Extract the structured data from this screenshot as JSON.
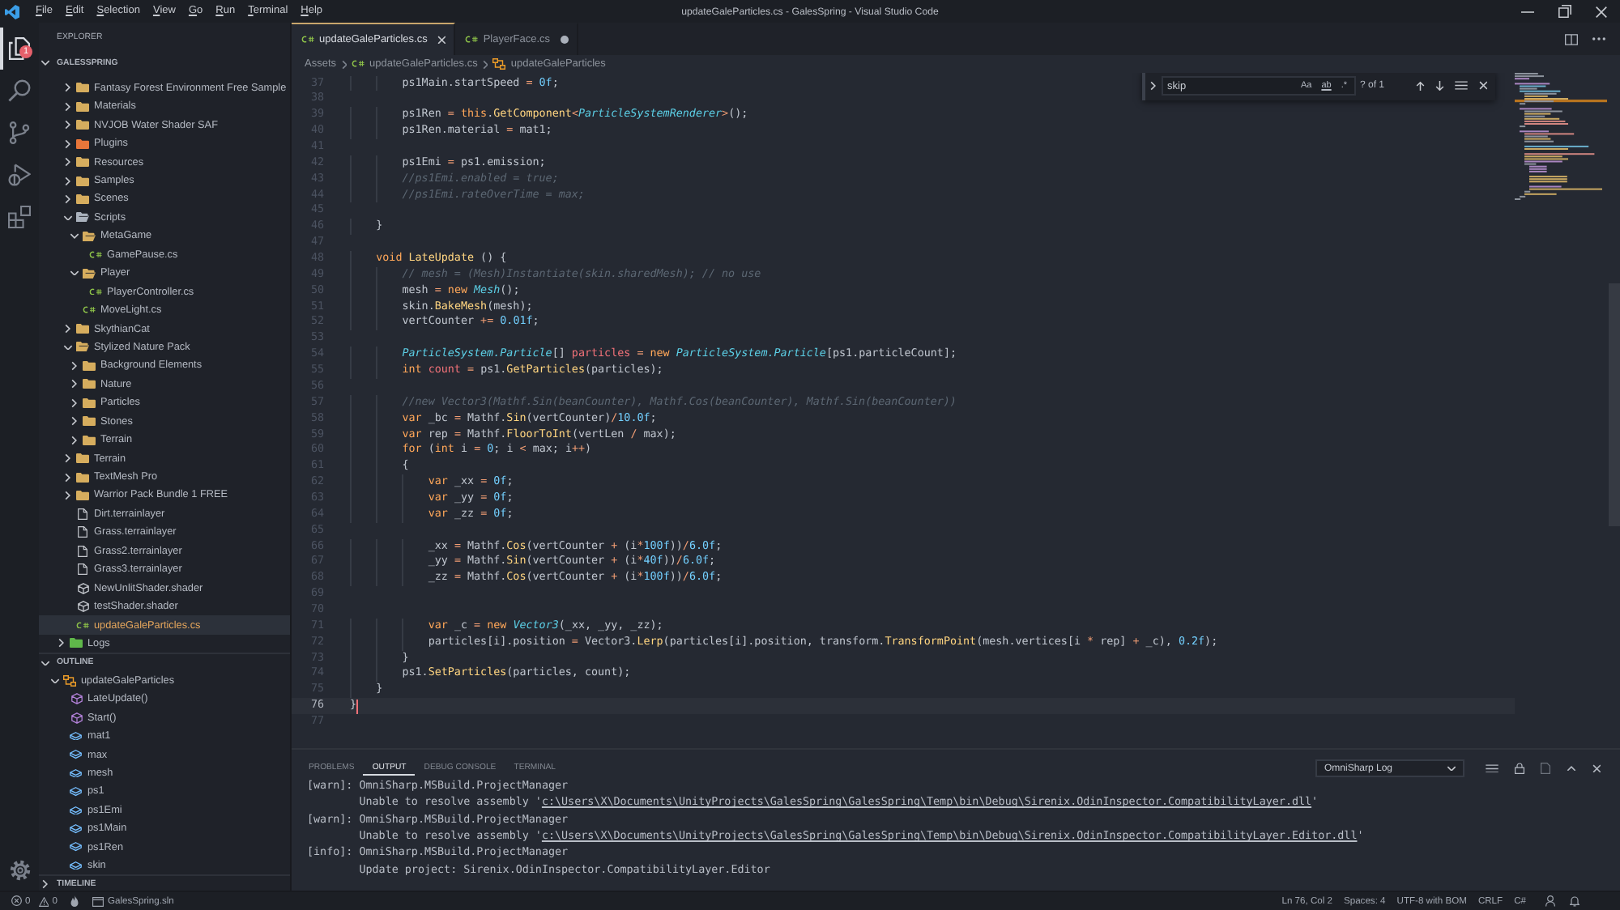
{
  "window": {
    "menu": [
      "File",
      "Edit",
      "Selection",
      "View",
      "Go",
      "Run",
      "Terminal",
      "Help"
    ],
    "title": "updateGaleParticles.cs - GalesSpring - Visual Studio Code"
  },
  "activity_bar": {
    "items": [
      {
        "kind": "files",
        "selected": true,
        "badge": "1"
      },
      {
        "kind": "search",
        "selected": false
      },
      {
        "kind": "branch",
        "selected": false
      },
      {
        "kind": "run",
        "selected": false
      },
      {
        "kind": "extensions",
        "selected": false
      }
    ]
  },
  "sidebar": {
    "title": "EXPLORER",
    "sections": [
      {
        "title": "GALESSPRING",
        "expanded": true,
        "tree": [
          {
            "children": [
              {
                "label": "Fantasy Forest Environment Free Sample",
                "kind": "folder",
                "color": "#d6ad5e",
                "expanded": false,
                "selected": false
              },
              {
                "label": "Materials",
                "kind": "folder",
                "color": "#d6ad5e",
                "expanded": false,
                "selected": false
              },
              {
                "label": "NVJOB Water Shader SAF",
                "kind": "folder",
                "color": "#d6ad5e",
                "expanded": false,
                "selected": false
              },
              {
                "label": "Plugins",
                "kind": "folder",
                "color": "#e8763a",
                "expanded": false,
                "selected": false
              },
              {
                "label": "Resources",
                "kind": "folder",
                "color": "#d6ad5e",
                "expanded": false,
                "selected": false
              },
              {
                "label": "Samples",
                "kind": "folder",
                "color": "#d6ad5e",
                "expanded": false,
                "selected": false
              },
              {
                "label": "Scenes",
                "kind": "folder",
                "color": "#d6ad5e",
                "expanded": false,
                "selected": false
              },
              {
                "label": "Scripts",
                "kind": "folder",
                "color": "#aab2bd",
                "expanded": true,
                "selected": false,
                "children": [
                  {
                    "label": "MetaGame",
                    "kind": "folder",
                    "color": "#d6ad5e",
                    "expanded": true,
                    "selected": false,
                    "children": [
                      {
                        "label": "GamePause.cs",
                        "kind": "csharp",
                        "selected": false
                      }
                    ]
                  },
                  {
                    "label": "Player",
                    "kind": "folder",
                    "color": "#d6ad5e",
                    "expanded": true,
                    "selected": false,
                    "children": [
                      {
                        "label": "PlayerController.cs",
                        "kind": "csharp",
                        "selected": false
                      }
                    ]
                  },
                  {
                    "label": "MoveLight.cs",
                    "kind": "csharp",
                    "selected": false
                  }
                ]
              },
              {
                "label": "SkythianCat",
                "kind": "folder",
                "color": "#d6ad5e",
                "expanded": false,
                "selected": false
              },
              {
                "label": "Stylized Nature Pack",
                "kind": "folder",
                "color": "#d6ad5e",
                "expanded": true,
                "selected": false,
                "children": [
                  {
                    "label": "Background Elements",
                    "kind": "folder",
                    "color": "#d6ad5e",
                    "expanded": false,
                    "selected": false
                  },
                  {
                    "label": "Nature",
                    "kind": "folder",
                    "color": "#d6ad5e",
                    "expanded": false,
                    "selected": false
                  },
                  {
                    "label": "Particles",
                    "kind": "folder",
                    "color": "#d6ad5e",
                    "expanded": false,
                    "selected": false
                  },
                  {
                    "label": "Stones",
                    "kind": "folder",
                    "color": "#d6ad5e",
                    "expanded": false,
                    "selected": false
                  },
                  {
                    "label": "Terrain",
                    "kind": "folder",
                    "color": "#d6ad5e",
                    "expanded": false,
                    "selected": false
                  }
                ]
              },
              {
                "label": "Terrain",
                "kind": "folder",
                "color": "#d6ad5e",
                "expanded": false,
                "selected": false
              },
              {
                "label": "TextMesh Pro",
                "kind": "folder",
                "color": "#d6ad5e",
                "expanded": false,
                "selected": false
              },
              {
                "label": "Warrior Pack Bundle 1 FREE",
                "kind": "folder",
                "color": "#d6ad5e",
                "expanded": false,
                "selected": false
              },
              {
                "label": "Dirt.terrainlayer",
                "kind": "layer",
                "selected": false
              },
              {
                "label": "Grass.terrainlayer",
                "kind": "layer",
                "selected": false
              },
              {
                "label": "Grass2.terrainlayer",
                "kind": "layer",
                "selected": false
              },
              {
                "label": "Grass3.terrainlayer",
                "kind": "layer",
                "selected": false
              },
              {
                "label": "NewUnlitShader.shader",
                "kind": "shader",
                "selected": false
              },
              {
                "label": "testShader.shader",
                "kind": "shader",
                "selected": false
              },
              {
                "label": "updateGaleParticles.cs",
                "kind": "csharp",
                "selected": true
              }
            ]
          },
          {
            "label": "Logs",
            "kind": "folder",
            "color": "#5fb84a",
            "expanded": false,
            "selected": false
          }
        ]
      },
      {
        "title": "OUTLINE",
        "expanded": true,
        "symbols": [
          {
            "label": "updateGaleParticles",
            "kind": "class",
            "expanded": true,
            "selected": false,
            "children": [
              {
                "label": "LateUpdate()",
                "kind": "method",
                "selected": false
              },
              {
                "label": "Start()",
                "kind": "method",
                "selected": false
              },
              {
                "label": "mat1",
                "kind": "field",
                "selected": false
              },
              {
                "label": "max",
                "kind": "field",
                "selected": false
              },
              {
                "label": "mesh",
                "kind": "field",
                "selected": false
              },
              {
                "label": "ps1",
                "kind": "field",
                "selected": false
              },
              {
                "label": "ps1Emi",
                "kind": "field",
                "selected": false
              },
              {
                "label": "ps1Main",
                "kind": "field",
                "selected": false
              },
              {
                "label": "ps1Ren",
                "kind": "field",
                "selected": false
              },
              {
                "label": "skin",
                "kind": "field",
                "selected": false
              }
            ]
          }
        ]
      },
      {
        "title": "TIMELINE",
        "expanded": false
      }
    ]
  },
  "editor": {
    "tabs": [
      {
        "label": "updateGaleParticles.cs",
        "selected": true,
        "dirty": false
      },
      {
        "label": "PlayerFace.cs",
        "selected": false,
        "dirty": true
      }
    ],
    "breadcrumbs": [
      {
        "label": "Assets",
        "kind": "folder"
      },
      {
        "label": "updateGaleParticles.cs",
        "kind": "csharp"
      },
      {
        "label": "updateGaleParticles",
        "kind": "class"
      }
    ],
    "find": {
      "query": "skip",
      "toggles": [
        {
          "label": "Aa",
          "on": false
        },
        {
          "label": "ab",
          "on": false
        },
        {
          "label": ".*",
          "on": false
        }
      ],
      "result": "? of 1"
    },
    "lines": [
      {
        "number": "37",
        "current": false,
        "tokens": [
          {
            "kind": "plain",
            "text": "        ps1Main.startSpeed "
          },
          {
            "kind": "operator",
            "text": "= "
          },
          {
            "kind": "number",
            "text": "0f"
          },
          {
            "kind": "plain",
            "text": ";"
          }
        ]
      },
      {
        "number": "38",
        "current": false
      },
      {
        "number": "39",
        "current": false,
        "tokens": [
          {
            "kind": "plain",
            "text": "        ps1Ren "
          },
          {
            "kind": "operator",
            "text": "= "
          },
          {
            "kind": "keyword",
            "text": "this"
          },
          {
            "kind": "plain",
            "text": "."
          },
          {
            "kind": "function",
            "text": "GetComponent"
          },
          {
            "kind": "operator",
            "text": "<"
          },
          {
            "kind": "type",
            "text": "ParticleSystemRenderer"
          },
          {
            "kind": "operator",
            "text": ">"
          },
          {
            "kind": "plain",
            "text": "();"
          }
        ]
      },
      {
        "number": "40",
        "current": false,
        "tokens": [
          {
            "kind": "plain",
            "text": "        ps1Ren.material "
          },
          {
            "kind": "operator",
            "text": "="
          },
          {
            "kind": "plain",
            "text": " mat1;"
          }
        ]
      },
      {
        "number": "41",
        "current": false
      },
      {
        "number": "42",
        "current": false,
        "tokens": [
          {
            "kind": "plain",
            "text": "        ps1Emi "
          },
          {
            "kind": "operator",
            "text": "="
          },
          {
            "kind": "plain",
            "text": " ps1.emission;"
          }
        ]
      },
      {
        "number": "43",
        "current": false,
        "tokens": [
          {
            "kind": "comment",
            "text": "        //ps1Emi.enabled = true;"
          }
        ]
      },
      {
        "number": "44",
        "current": false,
        "tokens": [
          {
            "kind": "comment",
            "text": "        //ps1Emi.rateOverTime = max;"
          }
        ]
      },
      {
        "number": "45",
        "current": false
      },
      {
        "number": "46",
        "current": false,
        "tokens": [
          {
            "kind": "plain",
            "text": "    }"
          }
        ]
      },
      {
        "number": "47",
        "current": false
      },
      {
        "number": "48",
        "current": false,
        "tokens": [
          {
            "kind": "keyword",
            "text": "    void "
          },
          {
            "kind": "function",
            "text": "LateUpdate"
          },
          {
            "kind": "plain",
            "text": " () {"
          }
        ]
      },
      {
        "number": "49",
        "current": false,
        "tokens": [
          {
            "kind": "comment",
            "text": "        // mesh = (Mesh)Instantiate(skin.sharedMesh); // no use"
          }
        ]
      },
      {
        "number": "50",
        "current": false,
        "tokens": [
          {
            "kind": "plain",
            "text": "        mesh "
          },
          {
            "kind": "operator",
            "text": "= "
          },
          {
            "kind": "keyword",
            "text": "new "
          },
          {
            "kind": "type",
            "text": "Mesh"
          },
          {
            "kind": "plain",
            "text": "();"
          }
        ]
      },
      {
        "number": "51",
        "current": false,
        "tokens": [
          {
            "kind": "plain",
            "text": "        skin."
          },
          {
            "kind": "function",
            "text": "BakeMesh"
          },
          {
            "kind": "plain",
            "text": "(mesh);"
          }
        ]
      },
      {
        "number": "52",
        "current": false,
        "tokens": [
          {
            "kind": "plain",
            "text": "        vertCounter "
          },
          {
            "kind": "operator",
            "text": "+= "
          },
          {
            "kind": "number",
            "text": "0.01f"
          },
          {
            "kind": "plain",
            "text": ";"
          }
        ]
      },
      {
        "number": "53",
        "current": false
      },
      {
        "number": "54",
        "current": false,
        "tokens": [
          {
            "kind": "type",
            "text": "        ParticleSystem.Particle"
          },
          {
            "kind": "plain",
            "text": "[] "
          },
          {
            "kind": "variable",
            "text": "particles "
          },
          {
            "kind": "operator",
            "text": "= "
          },
          {
            "kind": "keyword",
            "text": "new "
          },
          {
            "kind": "type",
            "text": "ParticleSystem.Particle"
          },
          {
            "kind": "plain",
            "text": "[ps1.particleCount];"
          }
        ]
      },
      {
        "number": "55",
        "current": false,
        "tokens": [
          {
            "kind": "keyword",
            "text": "        int "
          },
          {
            "kind": "variable",
            "text": "count "
          },
          {
            "kind": "operator",
            "text": "= "
          },
          {
            "kind": "plain",
            "text": "ps1."
          },
          {
            "kind": "function",
            "text": "GetParticles"
          },
          {
            "kind": "plain",
            "text": "(particles);"
          }
        ]
      },
      {
        "number": "56",
        "current": false
      },
      {
        "number": "57",
        "current": false,
        "tokens": [
          {
            "kind": "comment",
            "text": "        //new Vector3(Mathf.Sin(beanCounter), Mathf.Cos(beanCounter), Mathf.Sin(beanCounter))"
          }
        ]
      },
      {
        "number": "58",
        "current": false,
        "tokens": [
          {
            "kind": "keyword",
            "text": "        var"
          },
          {
            "kind": "plain",
            "text": " _bc "
          },
          {
            "kind": "operator",
            "text": "="
          },
          {
            "kind": "plain",
            "text": " Mathf."
          },
          {
            "kind": "function",
            "text": "Sin"
          },
          {
            "kind": "plain",
            "text": "(vertCounter)"
          },
          {
            "kind": "operator",
            "text": "/"
          },
          {
            "kind": "number",
            "text": "10.0f"
          },
          {
            "kind": "plain",
            "text": ";"
          }
        ]
      },
      {
        "number": "59",
        "current": false,
        "tokens": [
          {
            "kind": "keyword",
            "text": "        var"
          },
          {
            "kind": "plain",
            "text": " rep "
          },
          {
            "kind": "operator",
            "text": "="
          },
          {
            "kind": "plain",
            "text": " Mathf."
          },
          {
            "kind": "function",
            "text": "FloorToInt"
          },
          {
            "kind": "plain",
            "text": "(vertLen "
          },
          {
            "kind": "operator",
            "text": "/"
          },
          {
            "kind": "plain",
            "text": " max);"
          }
        ]
      },
      {
        "number": "60",
        "current": false,
        "tokens": [
          {
            "kind": "keyword",
            "text": "        for"
          },
          {
            "kind": "plain",
            "text": " ("
          },
          {
            "kind": "keyword",
            "text": "int"
          },
          {
            "kind": "plain",
            "text": " i "
          },
          {
            "kind": "operator",
            "text": "= "
          },
          {
            "kind": "number",
            "text": "0"
          },
          {
            "kind": "plain",
            "text": "; i "
          },
          {
            "kind": "operator",
            "text": "<"
          },
          {
            "kind": "plain",
            "text": " max; i"
          },
          {
            "kind": "operator",
            "text": "++"
          },
          {
            "kind": "plain",
            "text": ")"
          }
        ]
      },
      {
        "number": "61",
        "current": false,
        "tokens": [
          {
            "kind": "plain",
            "text": "        {"
          }
        ]
      },
      {
        "number": "62",
        "current": false,
        "tokens": [
          {
            "kind": "keyword",
            "text": "            var"
          },
          {
            "kind": "plain",
            "text": " _xx "
          },
          {
            "kind": "operator",
            "text": "= "
          },
          {
            "kind": "number",
            "text": "0f"
          },
          {
            "kind": "plain",
            "text": ";"
          }
        ]
      },
      {
        "number": "63",
        "current": false,
        "tokens": [
          {
            "kind": "keyword",
            "text": "            var"
          },
          {
            "kind": "plain",
            "text": " _yy "
          },
          {
            "kind": "operator",
            "text": "= "
          },
          {
            "kind": "number",
            "text": "0f"
          },
          {
            "kind": "plain",
            "text": ";"
          }
        ]
      },
      {
        "number": "64",
        "current": false,
        "tokens": [
          {
            "kind": "keyword",
            "text": "            var"
          },
          {
            "kind": "plain",
            "text": " _zz "
          },
          {
            "kind": "operator",
            "text": "= "
          },
          {
            "kind": "number",
            "text": "0f"
          },
          {
            "kind": "plain",
            "text": ";"
          }
        ]
      },
      {
        "number": "65",
        "current": false
      },
      {
        "number": "66",
        "current": false,
        "tokens": [
          {
            "kind": "plain",
            "text": "            _xx "
          },
          {
            "kind": "operator",
            "text": "="
          },
          {
            "kind": "plain",
            "text": " Mathf."
          },
          {
            "kind": "function",
            "text": "Cos"
          },
          {
            "kind": "plain",
            "text": "(vertCounter "
          },
          {
            "kind": "operator",
            "text": "+"
          },
          {
            "kind": "plain",
            "text": " (i"
          },
          {
            "kind": "operator",
            "text": "*"
          },
          {
            "kind": "number",
            "text": "100f"
          },
          {
            "kind": "plain",
            "text": "))"
          },
          {
            "kind": "operator",
            "text": "/"
          },
          {
            "kind": "number",
            "text": "6.0f"
          },
          {
            "kind": "plain",
            "text": ";"
          }
        ]
      },
      {
        "number": "67",
        "current": false,
        "tokens": [
          {
            "kind": "plain",
            "text": "            _yy "
          },
          {
            "kind": "operator",
            "text": "="
          },
          {
            "kind": "plain",
            "text": " Mathf."
          },
          {
            "kind": "function",
            "text": "Sin"
          },
          {
            "kind": "plain",
            "text": "(vertCounter "
          },
          {
            "kind": "operator",
            "text": "+"
          },
          {
            "kind": "plain",
            "text": " (i"
          },
          {
            "kind": "operator",
            "text": "*"
          },
          {
            "kind": "number",
            "text": "40f"
          },
          {
            "kind": "plain",
            "text": "))"
          },
          {
            "kind": "operator",
            "text": "/"
          },
          {
            "kind": "number",
            "text": "6.0f"
          },
          {
            "kind": "plain",
            "text": ";"
          }
        ]
      },
      {
        "number": "68",
        "current": false,
        "tokens": [
          {
            "kind": "plain",
            "text": "            _zz "
          },
          {
            "kind": "operator",
            "text": "="
          },
          {
            "kind": "plain",
            "text": " Mathf."
          },
          {
            "kind": "function",
            "text": "Cos"
          },
          {
            "kind": "plain",
            "text": "(vertCounter "
          },
          {
            "kind": "operator",
            "text": "+"
          },
          {
            "kind": "plain",
            "text": " (i"
          },
          {
            "kind": "operator",
            "text": "*"
          },
          {
            "kind": "number",
            "text": "100f"
          },
          {
            "kind": "plain",
            "text": "))"
          },
          {
            "kind": "operator",
            "text": "/"
          },
          {
            "kind": "number",
            "text": "6.0f"
          },
          {
            "kind": "plain",
            "text": ";"
          }
        ]
      },
      {
        "number": "69",
        "current": false
      },
      {
        "number": "70",
        "current": false
      },
      {
        "number": "71",
        "current": false,
        "tokens": [
          {
            "kind": "keyword",
            "text": "            var"
          },
          {
            "kind": "plain",
            "text": " _c "
          },
          {
            "kind": "operator",
            "text": "= "
          },
          {
            "kind": "keyword",
            "text": "new "
          },
          {
            "kind": "type",
            "text": "Vector3"
          },
          {
            "kind": "plain",
            "text": "(_xx, _yy, _zz);"
          }
        ]
      },
      {
        "number": "72",
        "current": false,
        "tokens": [
          {
            "kind": "plain",
            "text": "            particles[i].position "
          },
          {
            "kind": "operator",
            "text": "="
          },
          {
            "kind": "plain",
            "text": " Vector3."
          },
          {
            "kind": "function",
            "text": "Lerp"
          },
          {
            "kind": "plain",
            "text": "(particles[i].position, transform."
          },
          {
            "kind": "function",
            "text": "TransformPoint"
          },
          {
            "kind": "plain",
            "text": "(mesh.vertices[i "
          },
          {
            "kind": "operator",
            "text": "*"
          },
          {
            "kind": "plain",
            "text": " rep] "
          },
          {
            "kind": "operator",
            "text": "+"
          },
          {
            "kind": "plain",
            "text": " _c), "
          },
          {
            "kind": "number",
            "text": "0.2f"
          },
          {
            "kind": "plain",
            "text": ");"
          }
        ]
      },
      {
        "number": "73",
        "current": false,
        "tokens": [
          {
            "kind": "plain",
            "text": "        }"
          }
        ]
      },
      {
        "number": "74",
        "current": false,
        "tokens": [
          {
            "kind": "plain",
            "text": "        ps1."
          },
          {
            "kind": "function",
            "text": "SetParticles"
          },
          {
            "kind": "plain",
            "text": "(particles, count);"
          }
        ]
      },
      {
        "number": "75",
        "current": false,
        "tokens": [
          {
            "kind": "plain",
            "text": "    }"
          }
        ]
      },
      {
        "number": "76",
        "current": true,
        "tokens": [
          {
            "kind": "plain",
            "text": "}"
          }
        ]
      },
      {
        "number": "77",
        "current": false
      }
    ]
  },
  "panel": {
    "tabs": [
      {
        "label": "PROBLEMS",
        "selected": false
      },
      {
        "label": "OUTPUT",
        "selected": true
      },
      {
        "label": "DEBUG CONSOLE",
        "selected": false
      },
      {
        "label": "TERMINAL",
        "selected": false
      }
    ],
    "channel": "OmniSharp Log",
    "lines": [
      {
        "text": "[warn]: OmniSharp.MSBuild.ProjectManager"
      },
      {
        "text": "        Unable to resolve assembly '",
        "link": "c:\\Users\\X\\Documents\\UnityProjects\\GalesSpring\\GalesSpring\\Temp\\bin\\Debug\\Sirenix.OdinInspector.CompatibilityLayer.dll",
        "after": "'"
      },
      {
        "text": "[warn]: OmniSharp.MSBuild.ProjectManager"
      },
      {
        "text": "        Unable to resolve assembly '",
        "link": "c:\\Users\\X\\Documents\\UnityProjects\\GalesSpring\\GalesSpring\\Temp\\bin\\Debug\\Sirenix.OdinInspector.CompatibilityLayer.Editor.dll",
        "after": "'"
      },
      {
        "text": "[info]: OmniSharp.MSBuild.ProjectManager"
      },
      {
        "text": "        Update project: Sirenix.OdinInspector.CompatibilityLayer.Editor"
      }
    ]
  },
  "status_bar": {
    "errors": "0",
    "warnings": "0",
    "workspace": "GalesSpring.sln",
    "position": "Ln 76, Col 2",
    "indentation": "Spaces: 4",
    "encoding": "UTF-8 with BOM",
    "line_ending": "CRLF",
    "language": "C#"
  }
}
